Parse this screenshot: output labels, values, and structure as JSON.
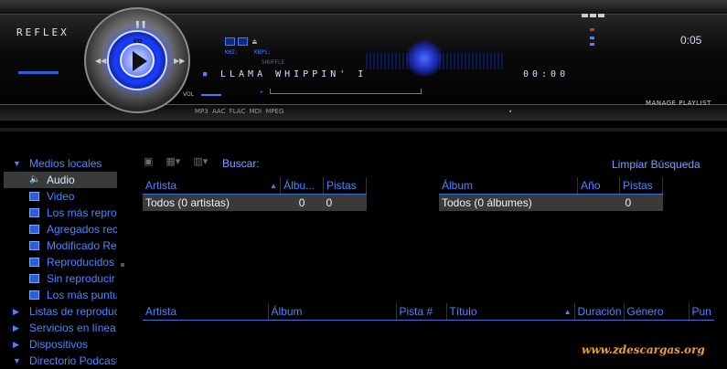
{
  "player": {
    "logo": "REFLEX",
    "track_title": "LLAMA WHIPPIN' I",
    "track_position": "00:00",
    "time": "0:05",
    "volume_label": "VOL",
    "khz_label": "KHZ:",
    "kbps_label": "KBPS:",
    "shuffle_label": "SHUFFLE",
    "eq_label": "EQ",
    "codecs": "MP3 AAC FLAC MDI MPEG",
    "manage_playlist": "MANAGE PLAYLIST"
  },
  "library": {
    "search_label": "Buscar:",
    "clear_search": "Limpiar Búsqueda",
    "sidebar": {
      "items": [
        {
          "label": "Medios locales",
          "level": "top",
          "expanded": true
        },
        {
          "label": "Audio",
          "level": "sub",
          "icon": "speaker-icon",
          "selected": true
        },
        {
          "label": "Video",
          "level": "sub",
          "icon": "video-icon"
        },
        {
          "label": "Los más reproducidos",
          "level": "sub",
          "icon": "playlist-icon"
        },
        {
          "label": "Agregados recientemente",
          "level": "sub",
          "icon": "playlist-icon"
        },
        {
          "label": "Modificado Recientemente",
          "level": "sub",
          "icon": "playlist-icon"
        },
        {
          "label": "Reproducidos recientemente",
          "level": "sub",
          "icon": "playlist-icon"
        },
        {
          "label": "Sin reproducir",
          "level": "sub",
          "icon": "playlist-icon"
        },
        {
          "label": "Los más puntuados",
          "level": "sub",
          "icon": "playlist-icon"
        },
        {
          "label": "Listas de reproducción",
          "level": "top",
          "expanded": false
        },
        {
          "label": "Servicios en línea",
          "level": "top",
          "expanded": false
        },
        {
          "label": "Dispositivos",
          "level": "top",
          "expanded": false
        },
        {
          "label": "Directorio Podcast",
          "level": "top",
          "expanded": true
        }
      ]
    },
    "artists_table": {
      "headers": [
        "Artista",
        "Álbu...",
        "Pistas"
      ],
      "rows": [
        [
          "Todos (0 artistas)",
          "0",
          "0"
        ]
      ]
    },
    "albums_table": {
      "headers": [
        "Álbum",
        "Año",
        "Pistas"
      ],
      "rows": [
        [
          "Todos (0 álbumes)",
          "",
          "0"
        ]
      ]
    },
    "tracks_table": {
      "headers": [
        "Artista",
        "Álbum",
        "Pista #",
        "Título",
        "Duración",
        "Género",
        "Pun"
      ]
    },
    "watermark": "www.zdescargas.org"
  }
}
